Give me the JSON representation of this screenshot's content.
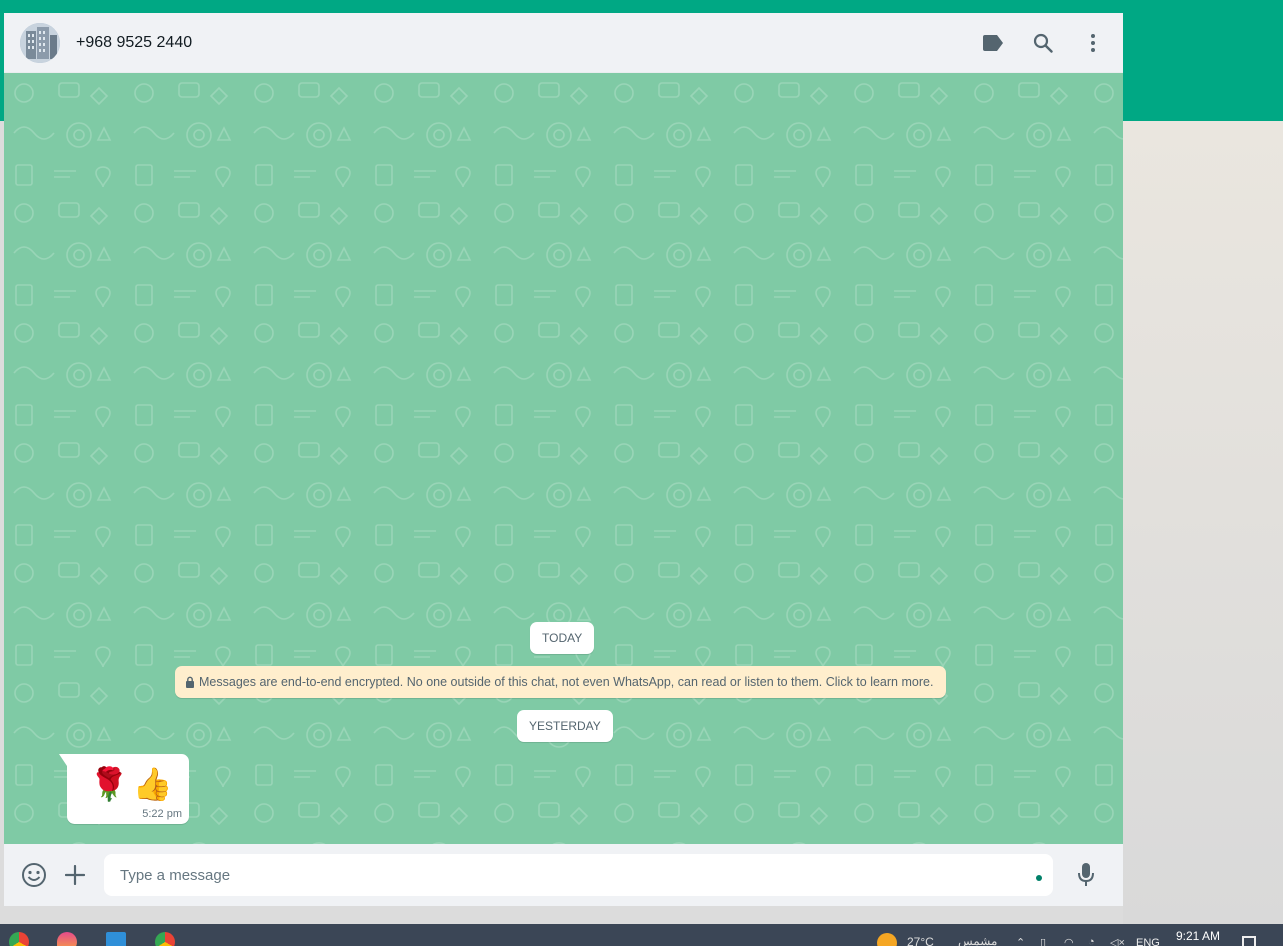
{
  "chat": {
    "contact_name": "+968 9525 2440",
    "header_icons": [
      "label-icon",
      "search-icon",
      "menu-icon"
    ]
  },
  "messages": {
    "today_chip": "TODAY",
    "encryption_notice": "Messages are end-to-end encrypted. No one outside of this chat, not even WhatsApp, can read or listen to them. Click to learn more.",
    "yesterday_chip": "YESTERDAY",
    "items": [
      {
        "direction": "incoming",
        "text": "🌹👍",
        "time": "5:22 pm"
      }
    ]
  },
  "composer": {
    "placeholder": "Type a message",
    "icons": [
      "emoji-icon",
      "plus-icon",
      "mic-icon"
    ]
  },
  "taskbar": {
    "apps": [
      "chrome-icon",
      "app-icon",
      "photos-icon",
      "chrome-icon"
    ],
    "weather": "27°C",
    "rtl_text": "مشمس",
    "language": "ENG",
    "time": "9:21 AM"
  },
  "colors": {
    "header_green": "#00a884",
    "chat_background": "#7fcaa5",
    "encryption_bg": "#ffeecd",
    "panel_bg": "#f0f2f5"
  }
}
